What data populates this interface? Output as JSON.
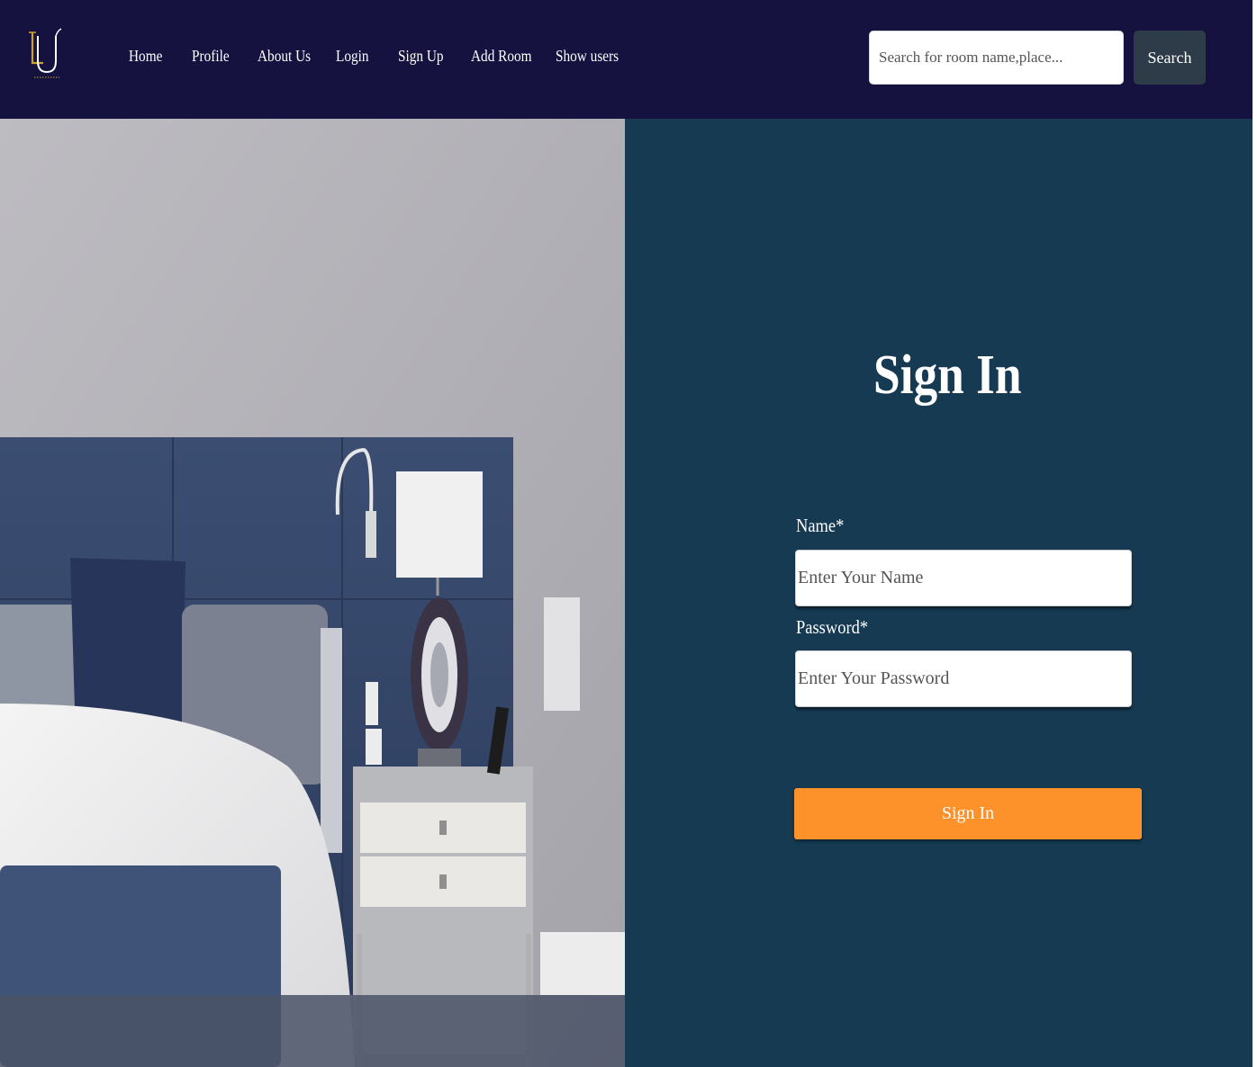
{
  "nav": {
    "links": [
      {
        "label": "Home"
      },
      {
        "label": "Profile"
      },
      {
        "label": "About Us"
      },
      {
        "label": "Login"
      },
      {
        "label": "Sign Up"
      },
      {
        "label": "Add Room"
      },
      {
        "label": "Show users"
      }
    ],
    "search_placeholder": "Search for room name,place...",
    "search_label": "Search"
  },
  "logo": {
    "icon": "lu-monogram-logo",
    "colors": [
      "#c9a227",
      "#ffffff"
    ]
  },
  "hero": {
    "icon": "bedroom-photo"
  },
  "form": {
    "title": "Sign In",
    "name_label": "Name*",
    "name_placeholder": "Enter Your Name",
    "password_label": "Password*",
    "password_placeholder": "Enter Your Password",
    "submit_label": "Sign In"
  },
  "colors": {
    "navbar": "#15123f",
    "panel": "#153a52",
    "accent": "#fd912a",
    "search_button": "#2d3c48"
  }
}
